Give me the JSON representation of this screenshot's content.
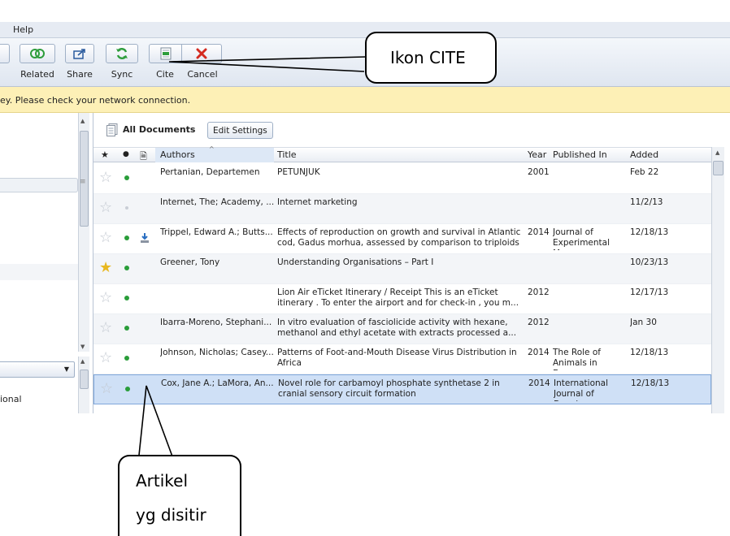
{
  "menubar": {
    "help": "Help"
  },
  "toolbar": {
    "buttons": [
      {
        "label": "Related",
        "icon": "related-icon"
      },
      {
        "label": "Share",
        "icon": "share-icon"
      },
      {
        "label": "Sync",
        "icon": "sync-icon"
      },
      {
        "label": "Cite",
        "icon": "cite-icon"
      },
      {
        "label": "Cancel",
        "icon": "cancel-icon"
      }
    ]
  },
  "warning": {
    "text": "ey. Please check your network connection."
  },
  "left_pane": {
    "fragment": "ional"
  },
  "documents": {
    "title": "All Documents",
    "edit_settings": "Edit Settings",
    "columns": {
      "star": "★",
      "read": "●",
      "file": "🗎",
      "authors": "Authors",
      "title": "Title",
      "year": "Year",
      "published_in": "Published In",
      "added": "Added"
    },
    "rows": [
      {
        "authors": "Pertanian, Departemen",
        "title": "PETUNJUK",
        "year": "2001",
        "published_in": "",
        "added": "Feb 22",
        "favorite": false,
        "read": "green",
        "file": false
      },
      {
        "authors": "Internet, The; Academy, ...",
        "title": "Internet marketing",
        "year": "",
        "published_in": "",
        "added": "11/2/13",
        "favorite": false,
        "read": "grey",
        "file": false
      },
      {
        "authors": "Trippel, Edward A.; Butts...",
        "title": "Effects of reproduction on growth and survival in Atlantic cod, Gadus morhua, assessed by comparison to triploids",
        "year": "2014",
        "published_in": "Journal of Experimental M...",
        "added": "12/18/13",
        "favorite": false,
        "read": "green",
        "file": true
      },
      {
        "authors": "Greener, Tony",
        "title": "Understanding Organisations – Part I",
        "year": "",
        "published_in": "",
        "added": "10/23/13",
        "favorite": true,
        "read": "green",
        "file": false
      },
      {
        "authors": "",
        "title": "Lion Air eTicket Itinerary / Receipt This is an eTicket itinerary . To enter the airport and for check-in , you m...",
        "year": "2012",
        "published_in": "",
        "added": "12/17/13",
        "favorite": false,
        "read": "green",
        "file": false
      },
      {
        "authors": "Ibarra-Moreno, Stephani...",
        "title": "In vitro evaluation of fasciolicide activity with hexane, methanol and ethyl acetate with extracts processed a...",
        "year": "2012",
        "published_in": "",
        "added": "Jan 30",
        "favorite": false,
        "read": "green",
        "file": false
      },
      {
        "authors": "Johnson, Nicholas; Casey...",
        "title": "Patterns of Foot-and-Mouth Disease Virus Distribution in Africa",
        "year": "2014",
        "published_in": "The Role of Animals in Emer...",
        "added": "12/18/13",
        "favorite": false,
        "read": "green",
        "file": false
      },
      {
        "authors": "Cox, Jane A.; LaMora, An...",
        "title": "Novel role for carbamoyl phosphate synthetase 2 in cranial sensory circuit formation",
        "year": "2014",
        "published_in": "International Journal of Devel...",
        "added": "12/18/13",
        "favorite": false,
        "read": "green",
        "file": false,
        "selected": true
      }
    ]
  },
  "callouts": {
    "cite": "Ikon CITE",
    "article_line1": "Artikel",
    "article_line2": "yg disitir"
  },
  "colors": {
    "read_dot": "#2a9d3a",
    "favorite_star": "#e8b820",
    "warning_bg": "#fdf0b6",
    "selection": "#cfe0f6"
  }
}
